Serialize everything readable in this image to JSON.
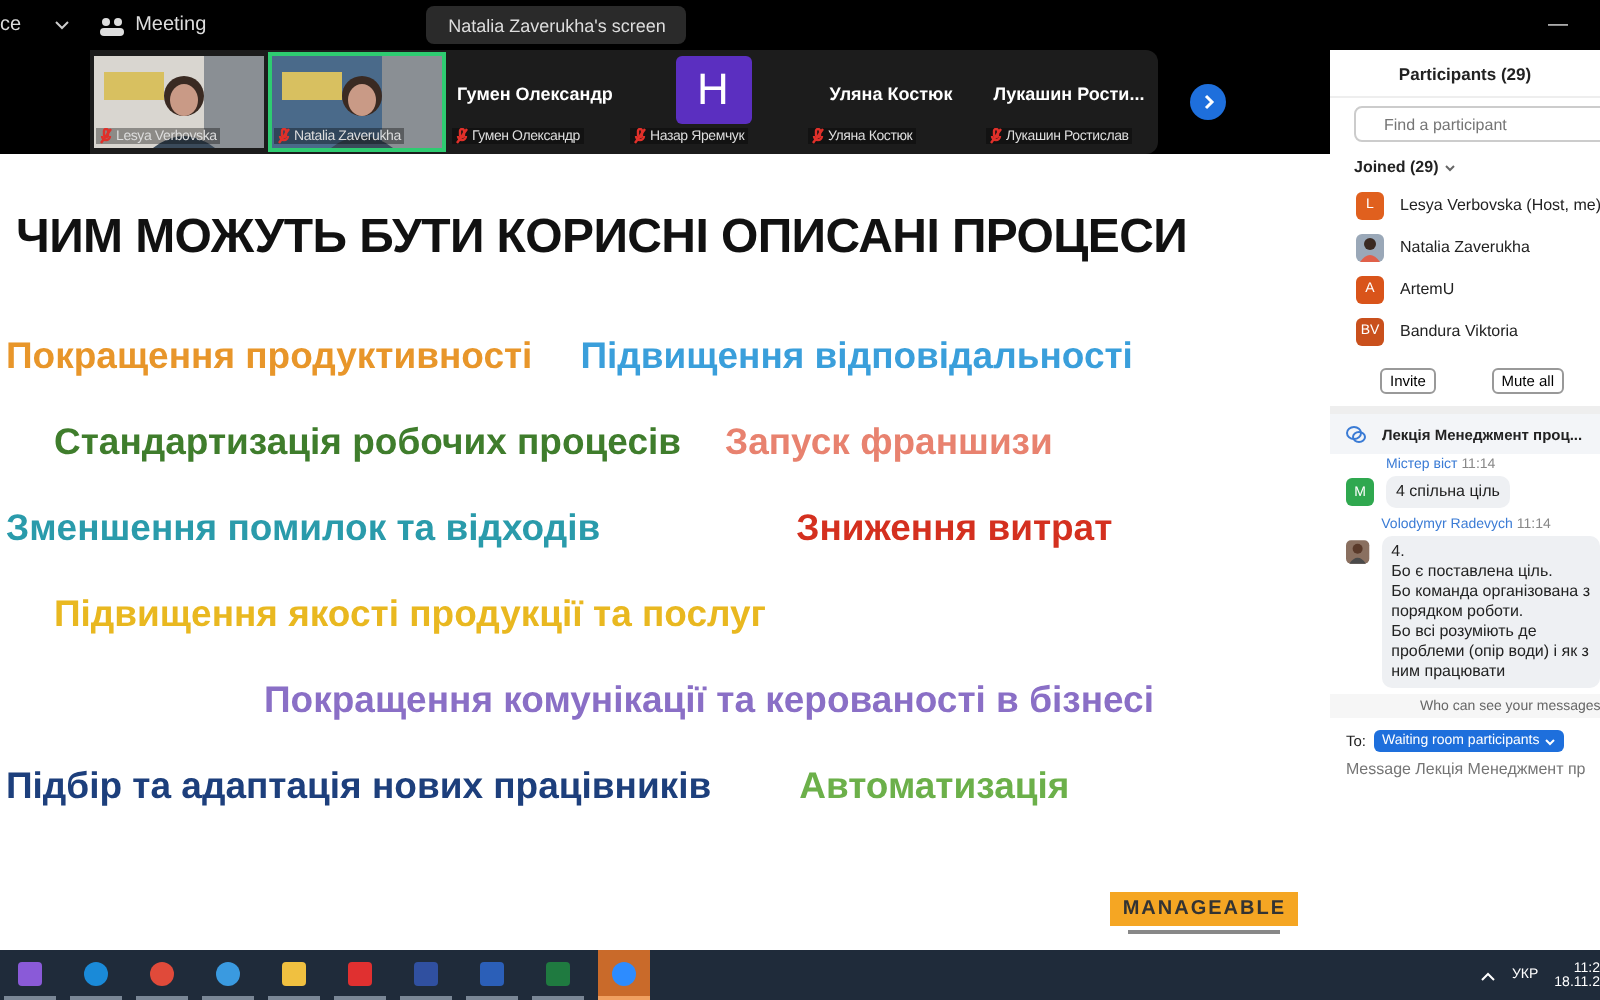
{
  "top_bar": {
    "app_label": "ce",
    "meeting_label": "Meeting",
    "share_label": "Natalia Zaverukha's screen",
    "minimize": "—"
  },
  "video_strip": {
    "tiles": [
      {
        "kind": "video",
        "label": "Lesya Verbovska",
        "active": false
      },
      {
        "kind": "video",
        "label": "Natalia Zaverukha",
        "active": true
      },
      {
        "kind": "name",
        "big_name": "Гумен Олександр",
        "label": "Гумен Олександр",
        "active": false
      },
      {
        "kind": "avatar",
        "letter": "H",
        "color": "#5b2fc0",
        "label": "Назар Яремчук",
        "active": false
      },
      {
        "kind": "name",
        "big_name": "Уляна Костюк",
        "label": "Уляна Костюк",
        "active": false
      },
      {
        "kind": "name",
        "big_name": "Лукашин  Рости...",
        "label": "Лукашин Ростислав",
        "active": false
      }
    ]
  },
  "slide": {
    "title": "ЧИМ МОЖУТЬ БУТИ КОРИСНІ ОПИСАНІ ПРОЦЕСИ",
    "rows": [
      [
        {
          "text": "Покращення продуктивності",
          "color": "#e8962a"
        },
        {
          "text": "Підвищення відповідальності",
          "color": "#3a9fdb"
        }
      ],
      [
        {
          "text": "Стандартизація робочих процесів",
          "color": "#3f7d2c"
        },
        {
          "text": "Запуск франшизи",
          "color": "#e8826f"
        }
      ],
      [
        {
          "text": "Зменшення помилок та відходів",
          "color": "#2a9bab"
        },
        {
          "text": "Зниження витрат",
          "color": "#d4301f"
        }
      ],
      [
        {
          "text": "Підвищення якості продукції та послуг",
          "color": "#e9b820"
        }
      ],
      [
        {
          "text": "Покращення комунікації та керованості в бізнесі",
          "color": "#8a6fc6"
        }
      ],
      [
        {
          "text": "Підбір та адаптація нових працівників",
          "color": "#1d3f7c"
        },
        {
          "text": "Автоматизація",
          "color": "#6cb04a"
        }
      ]
    ],
    "logo": "MANAGEABLE"
  },
  "participants": {
    "title": "Participants (29)",
    "search_placeholder": "Find a participant",
    "group": "Joined (29)",
    "items": [
      {
        "kind": "letter",
        "avatar": "L",
        "color": "#e0601e",
        "name": "Lesya Verbovska (Host, me)"
      },
      {
        "name": "Natalia Zaverukha"
      },
      {
        "kind": "letter",
        "avatar": "A",
        "color": "#d9541a",
        "name": "ArtemU"
      },
      {
        "kind": "letter",
        "avatar": "BV",
        "color": "#c9501c",
        "name": "Bandura Viktoria"
      }
    ],
    "buttons": [
      "Invite",
      "Mute all"
    ]
  },
  "chat": {
    "title": "Лекція Менеджмент проц...",
    "messages": [
      {
        "kind": "letter",
        "avatar": "M",
        "color": "#2fa84f",
        "sender": "Містер віст",
        "time": "11:14",
        "lines": [
          "4 спільна ціль"
        ]
      },
      {
        "sender": "Volodymyr Radevych",
        "time": "11:14",
        "lines": [
          "4.",
          "Бо є поставлена ціль.",
          "Бо команда організована з",
          "порядком роботи.",
          "Бо всі розуміють де",
          "проблеми (опір води) і як з",
          "ним працювати"
        ]
      }
    ],
    "privacy": "Who can see your messages",
    "to_label": "To:",
    "recipient": "Waiting room participants",
    "input_placeholder": "Message Лекція Менеджмент пр"
  },
  "taskbar": {
    "apps": [
      {
        "kind": "copilot",
        "selected": false
      },
      {
        "kind": "edge",
        "selected": false
      },
      {
        "kind": "chrome",
        "selected": false
      },
      {
        "kind": "badge",
        "selected": false
      },
      {
        "kind": "folder",
        "selected": false
      },
      {
        "kind": "pdf",
        "selected": false
      },
      {
        "kind": "save",
        "selected": false
      },
      {
        "kind": "word",
        "selected": false
      },
      {
        "kind": "excel",
        "selected": false
      },
      {
        "kind": "zoom",
        "selected": true
      }
    ],
    "language": "УКР",
    "time": "11:2",
    "date": "18.11.2"
  }
}
